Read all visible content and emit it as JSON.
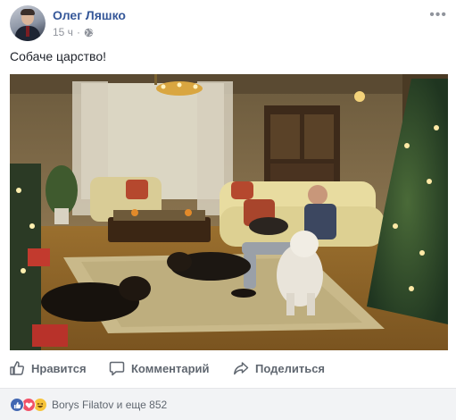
{
  "post": {
    "author": "Олег Ляшко",
    "time": "15 ч",
    "privacy_icon": "globe-icon",
    "menu_icon": "more-options-icon",
    "text": "Собаче царство!"
  },
  "actions": {
    "like_label": "Нравится",
    "comment_label": "Комментарий",
    "share_label": "Поделиться"
  },
  "reactions": {
    "icons": [
      "like-reaction-icon",
      "love-reaction-icon",
      "haha-reaction-icon"
    ],
    "summary": "Borys Filatov и еще 852"
  },
  "colors": {
    "author_link": "#365899",
    "secondary_text": "#90949c",
    "action_text": "#606770",
    "like_blue": "#4267b2",
    "love_red": "#f25268",
    "haha_yellow": "#f7c43a",
    "footer_bg": "#f2f3f5"
  }
}
